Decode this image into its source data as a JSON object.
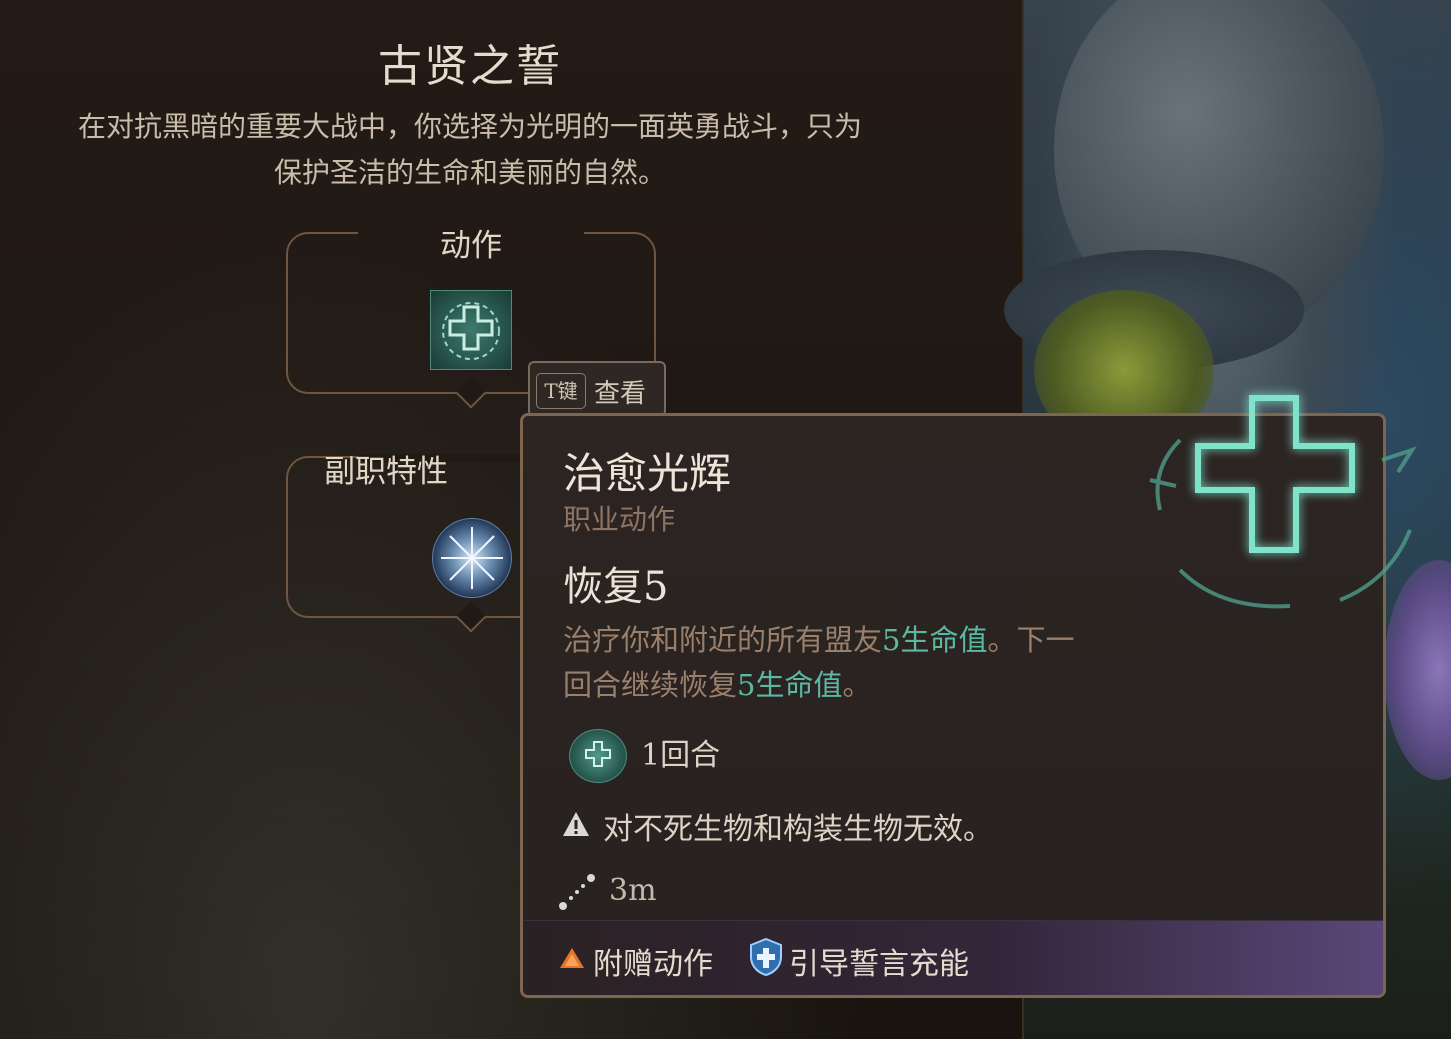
{
  "panel": {
    "title": "古贤之誓",
    "description_line1": "在对抗黑暗的重要大战中，你选择为光明的一面英勇战斗，只为",
    "description_line2": "保护圣洁的生命和美丽的自然。",
    "sections": {
      "actions_label": "动作",
      "subclass_label": "副职特性"
    }
  },
  "hotkey": {
    "key": "T键",
    "label": "查看"
  },
  "tooltip": {
    "name": "治愈光辉",
    "type": "职业动作",
    "effect": "恢复5",
    "body": {
      "p1": "治疗你和附近的所有盟友",
      "h1": "5生命值",
      "p2": "。下一回合继续恢复",
      "h2": "5生命值",
      "p3": "。"
    },
    "duration": "1回合",
    "warning": "对不死生物和构装生物无效。",
    "range": "3m",
    "footer": {
      "cost1": "附赠动作",
      "cost2": "引导誓言充能"
    }
  },
  "colors": {
    "highlight": "#5cb7a3",
    "bonus_action": "#e8742a",
    "channel_oath": "#6fb0e8",
    "icon_teal": "#3d7a6c"
  },
  "icons": {
    "healing_radiance": "teal-cross-icon",
    "subclass_feature": "radiant-star-icon",
    "warning": "warning-triangle-icon",
    "range": "range-dots-icon",
    "bonus_action": "orange-triangle-icon",
    "channel_oath": "shield-cross-icon"
  }
}
